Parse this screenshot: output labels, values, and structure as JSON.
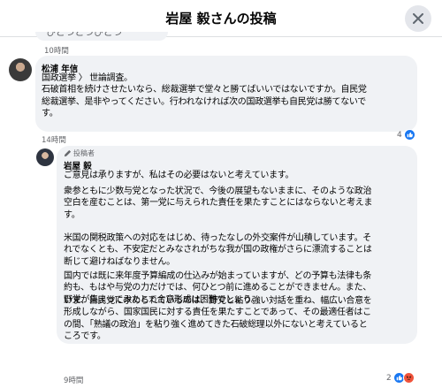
{
  "header": {
    "title": "岩屋 毅さんの投稿",
    "close_icon": "close-icon"
  },
  "prev": {
    "partial_text": "ひとつとつひとつ",
    "time": "10時間"
  },
  "comment1": {
    "author": "松浦 年信",
    "time": "14時間",
    "lines": [
      "国政選挙 〉 世論調査。",
      "石破首相を続けさせたいなら、総裁選挙で堂々と勝てばいいではないですか。自民党",
      "総裁選挙、是非やってください。行われなければ次の国政選挙も自民党は勝てないで",
      "す。"
    ],
    "reactions": {
      "count": "4",
      "icon": "like-icon"
    }
  },
  "reply": {
    "badge_label": "投稿者",
    "badge_icon": "pencil-icon",
    "author": "岩屋 毅",
    "time": "9時間",
    "paragraphs": [
      [
        "ご意見は承りますが、私はその必要はないと考えています。"
      ],
      [
        "衆参ともに少数与党となった状況で、今後の展望もないままに、そのような政治",
        "空白を産むことは、第一党に与えられた責任を果たすことにはならないと考えま",
        "す。"
      ],
      [
        "米国の関税政策への対応をはじめ、待ったなしの外交案件が山積しています。そ",
        "れでなくとも、不安定だとみなされがちな我が国の政権がさらに漂流することは",
        "断じて避けねばなりません。"
      ],
      [
        "国内では既に来年度予算編成の仕込みが始まっていますが、どの予算も法律も条",
        "約も、もはや与党の力だけでは、何ひとつ前に進めることができません。また、",
        "野党が集まってみたとて合意形成は困難でしょう。"
      ],
      [
        "いま、自民党に求められているのは、野党と粘り強い対話を重ね、幅広い合意を",
        "形成しながら、国家国民に対する責任を果たすことであって、その最適任者はこ",
        "の間、「熟議の政治」を粘り強く進めてきた石破総理以外にないと考えていると",
        "ころです。"
      ]
    ],
    "reactions": {
      "count": "2",
      "icons": [
        "like-icon",
        "angry-icon"
      ]
    }
  },
  "colors": {
    "like": "#1877f2",
    "angry": "#f0533b",
    "bubble": "#f0f2f5",
    "muted": "#65676b"
  }
}
